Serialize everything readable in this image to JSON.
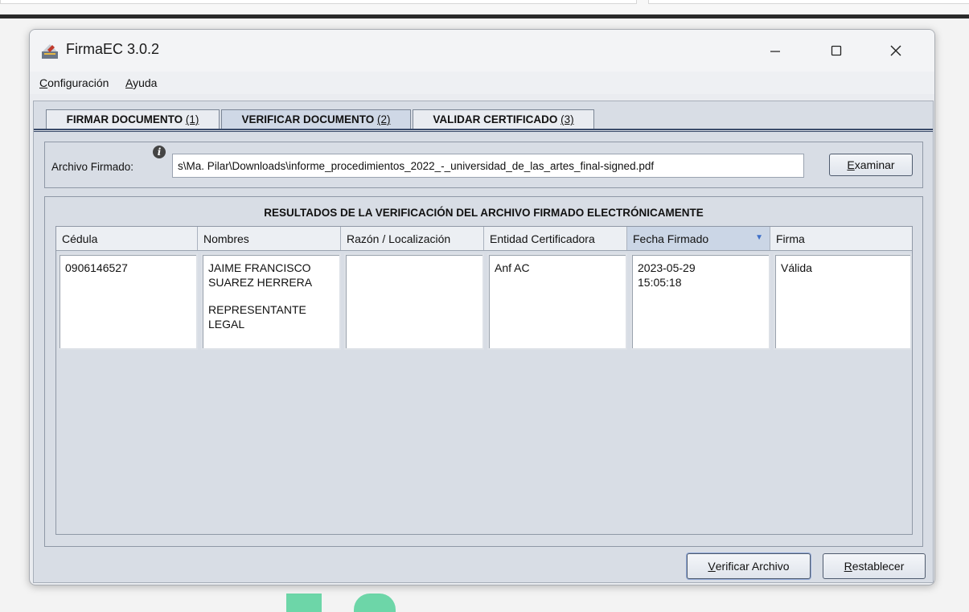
{
  "window": {
    "title": "FirmaEC 3.0.2"
  },
  "menu": {
    "configuracion_pre": "",
    "configuracion_u": "C",
    "configuracion_post": "onfiguración",
    "ayuda_u": "A",
    "ayuda_post": "yuda"
  },
  "tabs": [
    {
      "label": "FIRMAR DOCUMENTO ",
      "shortcut": "(1)"
    },
    {
      "label": "VERIFICAR DOCUMENTO ",
      "shortcut": "(2)"
    },
    {
      "label": "VALIDAR CERTIFICADO ",
      "shortcut": "(3)"
    }
  ],
  "file": {
    "label": "Archivo Firmado:",
    "info_icon": "info-icon",
    "value": "s\\Ma. Pilar\\Downloads\\informe_procedimientos_2022_-_universidad_de_las_artes_final-signed.pdf",
    "examinar_u": "E",
    "examinar_post": "xaminar"
  },
  "results": {
    "title": "RESULTADOS DE LA VERIFICACIÓN DEL ARCHIVO FIRMADO ELECTRÓNICAMENTE",
    "columns": [
      "Cédula",
      "Nombres",
      "Razón / Localización",
      "Entidad Certificadora",
      "Fecha Firmado",
      "Firma"
    ],
    "sorted_column": "Fecha Firmado",
    "rows": [
      {
        "cedula": "0906146527",
        "nombres_1": "JAIME FRANCISCO",
        "nombres_2": "SUAREZ HERRERA",
        "nombres_3": "REPRESENTANTE",
        "nombres_4": "LEGAL",
        "razon": "",
        "entidad": "Anf AC",
        "fecha_1": "2023-05-29",
        "fecha_2": "15:05:18",
        "firma": "Válida"
      }
    ]
  },
  "buttons": {
    "verificar_u": "V",
    "verificar_post": "erificar Archivo",
    "restablecer_u": "R",
    "restablecer_post": "establecer"
  },
  "colors": {
    "accent": "#3e6fc8",
    "panel": "#d8dde5",
    "tab_selected": "#cfd8e6"
  }
}
